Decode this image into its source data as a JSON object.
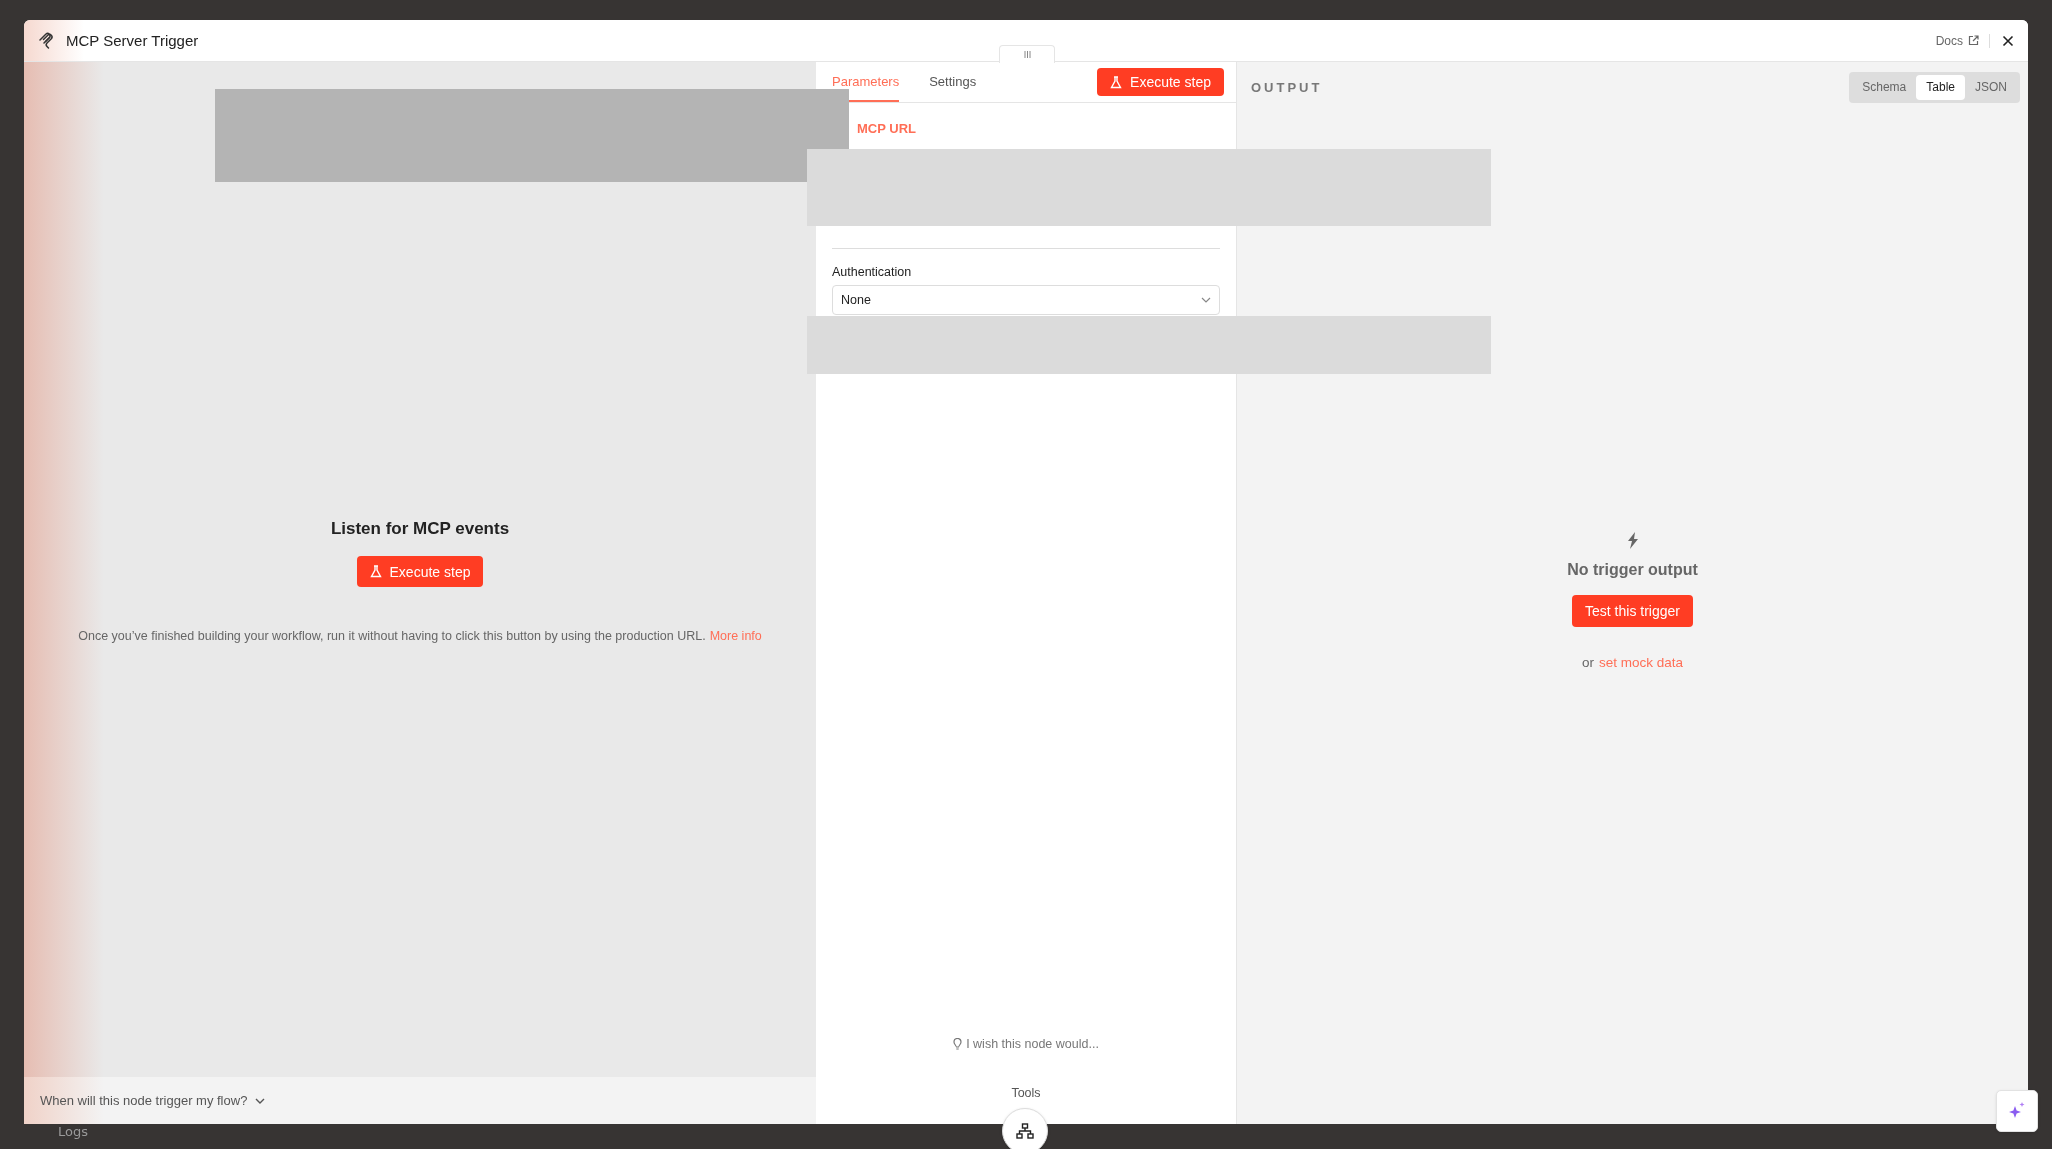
{
  "window": {
    "title": "MCP Server Trigger",
    "docs_link": "Docs"
  },
  "input_panel": {
    "heading": "Listen for MCP events",
    "execute_button": "Execute step",
    "note": "Once you’ve finished building your workflow, run it without having to click this button by using the production URL.",
    "more_info": "More info",
    "footer_toggle": "When will this node trigger my flow?"
  },
  "parameters_panel": {
    "tabs": [
      {
        "label": "Parameters",
        "selected": true
      },
      {
        "label": "Settings",
        "selected": false
      }
    ],
    "execute_button": "Execute step",
    "mcp_url_label": "MCP URL",
    "authentication": {
      "label": "Authentication",
      "value": "None"
    },
    "feedback": "I wish this node would...",
    "tools_label": "Tools"
  },
  "output_panel": {
    "title": "OUTPUT",
    "view_modes": [
      {
        "label": "Schema",
        "selected": false
      },
      {
        "label": "Table",
        "selected": true
      },
      {
        "label": "JSON",
        "selected": false
      }
    ],
    "empty_title": "No trigger output",
    "test_button": "Test this trigger",
    "mock_prefix": "or",
    "mock_link": "set mock data"
  },
  "background": {
    "logs_label": "Logs"
  }
}
